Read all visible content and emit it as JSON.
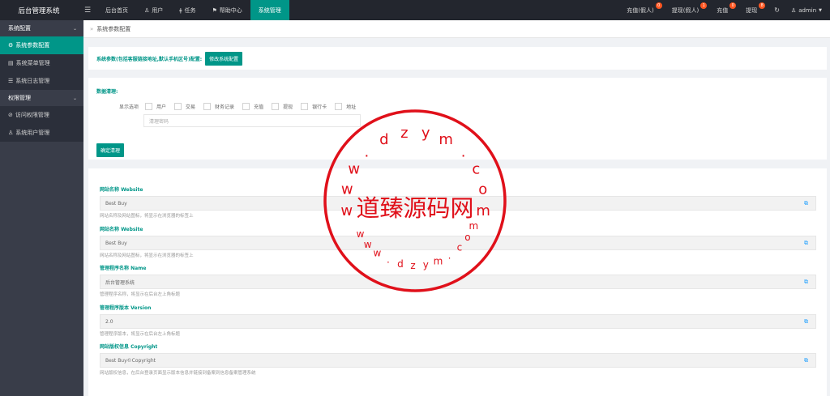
{
  "app": {
    "title": "后台管理系统"
  },
  "topnav": {
    "items": [
      {
        "label": "后台首页",
        "icon": ""
      },
      {
        "label": "用户",
        "icon": "user-icon"
      },
      {
        "label": "任务",
        "icon": "task-icon"
      },
      {
        "label": "帮助中心",
        "icon": "flag-icon"
      },
      {
        "label": "系统管理",
        "icon": ""
      }
    ],
    "active_index": 4
  },
  "topright": {
    "items": [
      {
        "label": "充值(假人)",
        "badge": "0"
      },
      {
        "label": "提现(假人)",
        "badge": "1"
      },
      {
        "label": "充值",
        "badge": "0"
      },
      {
        "label": "提现",
        "badge": "8"
      }
    ],
    "user": "admin"
  },
  "sidebar": {
    "group1": "系统配置",
    "group1_items": [
      "系统参数配置",
      "系统菜单管理",
      "系统日志管理"
    ],
    "group2": "权限管理",
    "group2_items": [
      "访问权限管理",
      "系统用户管理"
    ]
  },
  "breadcrumb": {
    "current": "系统参数配置"
  },
  "config_card": {
    "hint": "系统参数(包括客服链接地址,默认手机区号)配置:",
    "button": "修改系统配置"
  },
  "cleanup_card": {
    "title": "数据清理:",
    "options_label": "显示选项",
    "options": [
      "用户",
      "交易",
      "财务记录",
      "充值",
      "提现",
      "银行卡",
      "地址"
    ],
    "placeholder": "清理密码",
    "button": "确定清理"
  },
  "fields": [
    {
      "label": "网站名称 Website",
      "value": "Best Buy",
      "desc": "网站名称及网站图标，将显示在浏览器的标签上"
    },
    {
      "label": "网站名称 Website",
      "value": "Best Buy",
      "desc": "网站名称及网站图标，将显示在浏览器的标签上"
    },
    {
      "label": "管理程序名称 Name",
      "value": "后台管理系统",
      "desc": "管理程序名称，将显示在后台左上角标题"
    },
    {
      "label": "管理程序版本 Version",
      "value": "2.0",
      "desc": "管理程序版本，将显示在后台左上角标题"
    },
    {
      "label": "网站版权信息 Copyright",
      "value": "Best Buy©Copyright",
      "desc": "网站版权信息，在后台登录页面显示版本信息并链接到备案到信息备案管理系统"
    }
  ],
  "watermark": {
    "text": "道臻源码网",
    "ring_top": "www.dzym.com",
    "ring_bottom": "www.dzym.com",
    "color": "#e0101a"
  }
}
